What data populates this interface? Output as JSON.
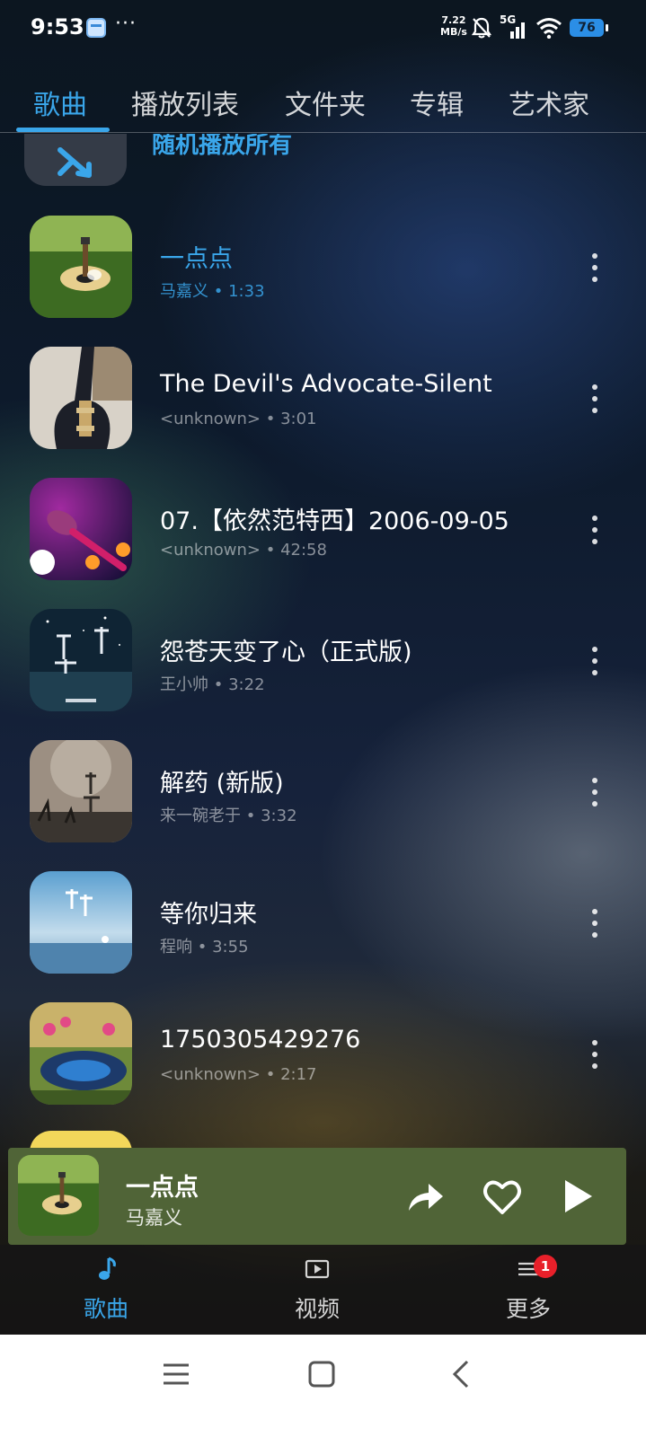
{
  "status_bar": {
    "time": "9:53",
    "dots": "···",
    "speed_value": "7.22",
    "speed_unit": "MB/s",
    "network": "5G",
    "battery": "76"
  },
  "tabs": [
    {
      "label": "歌曲",
      "active": true
    },
    {
      "label": "播放列表",
      "active": false
    },
    {
      "label": "文件夹",
      "active": false
    },
    {
      "label": "专辑",
      "active": false
    },
    {
      "label": "艺术家",
      "active": false
    }
  ],
  "shuffle": {
    "label": "随机播放所有",
    "icon": "shuffle-icon"
  },
  "songs": [
    {
      "title": "一点点",
      "artist": "马嘉义",
      "duration": "1:33",
      "separator": "•",
      "current": true,
      "cover_icon": "guitar-on-grass"
    },
    {
      "title": "The Devil's Advocate-Silent",
      "artist": "<unknown>",
      "duration": "3:01",
      "separator": "•",
      "current": false,
      "cover_icon": "electric-guitar"
    },
    {
      "title": "07.【依然范特西】2006-09-05",
      "artist": "<unknown>",
      "duration": "42:58",
      "separator": "•",
      "current": false,
      "cover_icon": "microphone"
    },
    {
      "title": "怨苍天变了心（正式版)",
      "artist": "王小帅",
      "duration": "3:22",
      "separator": "•",
      "current": false,
      "cover_icon": "night-sky-cover"
    },
    {
      "title": "解药 (新版)",
      "artist": "来一碗老于",
      "duration": "3:32",
      "separator": "•",
      "current": false,
      "cover_icon": "moon-cover"
    },
    {
      "title": "等你归来",
      "artist": "程响",
      "duration": "3:55",
      "separator": "•",
      "current": false,
      "cover_icon": "sea-cover"
    },
    {
      "title": "1750305429276",
      "artist": "<unknown>",
      "duration": "2:17",
      "separator": "•",
      "current": false,
      "cover_icon": "headphones-flowers"
    }
  ],
  "mini_player": {
    "title": "一点点",
    "artist": "马嘉义",
    "share_icon": "share-icon",
    "like_icon": "heart-icon",
    "play_icon": "play-icon",
    "background_color": "#506437"
  },
  "bottom_nav": [
    {
      "label": "歌曲",
      "icon": "music-note-icon",
      "active": true
    },
    {
      "label": "视频",
      "icon": "video-icon",
      "active": false
    },
    {
      "label": "更多",
      "icon": "menu-icon",
      "active": false,
      "badge": "1"
    }
  ],
  "system_nav": {
    "menu": "menu-icon",
    "home": "home-icon",
    "back": "back-icon"
  },
  "colors": {
    "accent": "#3aa6ea",
    "badge": "#e8202a"
  }
}
